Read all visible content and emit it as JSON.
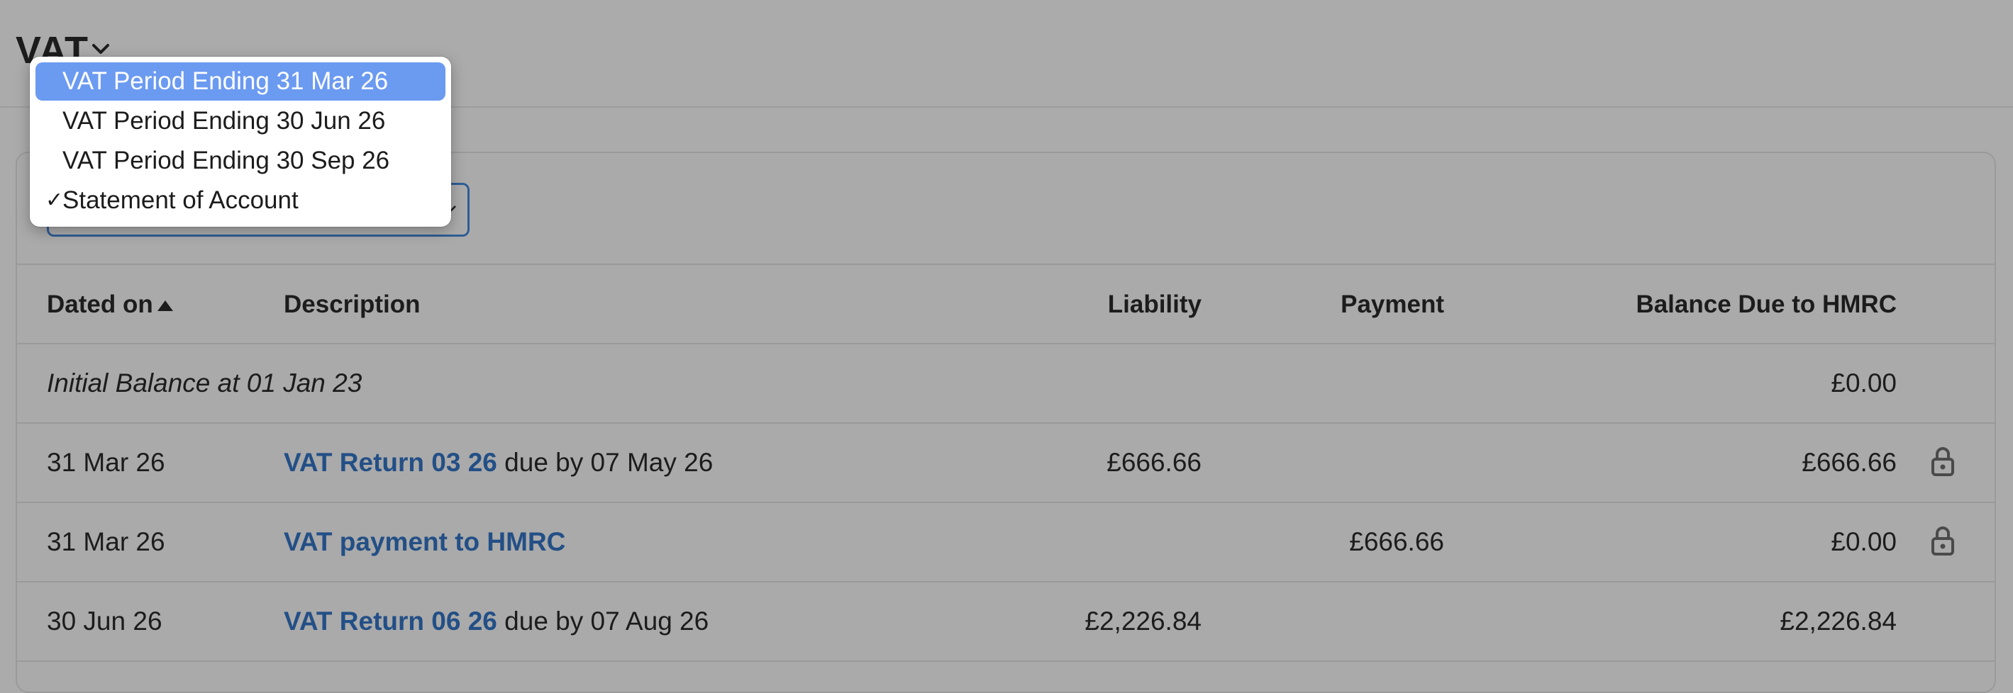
{
  "header": {
    "title": "VAT",
    "title_icon": "chevron-down-icon"
  },
  "dropdown": {
    "items": [
      {
        "label": "VAT Period Ending 31 Mar 26",
        "highlighted": true,
        "checked": false
      },
      {
        "label": "VAT Period Ending 30 Jun 26",
        "highlighted": false,
        "checked": false
      },
      {
        "label": "VAT Period Ending 30 Sep 26",
        "highlighted": false,
        "checked": false
      },
      {
        "label": "Statement of Account",
        "highlighted": false,
        "checked": true
      }
    ],
    "check_glyph": "✓"
  },
  "table": {
    "columns": {
      "dated_on": "Dated on",
      "description": "Description",
      "liability": "Liability",
      "payment": "Payment",
      "balance": "Balance Due to HMRC"
    },
    "sort": {
      "column": "dated_on",
      "direction": "ascending"
    },
    "initial": {
      "label": "Initial Balance at 01 Jan 23",
      "balance": "£0.00"
    },
    "rows": [
      {
        "date": "31 Mar 26",
        "link": "VAT Return 03 26",
        "suffix": " due by 07 May 26",
        "liability": "£666.66",
        "payment": "",
        "balance": "£666.66",
        "locked": true
      },
      {
        "date": "31 Mar 26",
        "link": "VAT payment to HMRC",
        "suffix": "",
        "liability": "",
        "payment": "£666.66",
        "balance": "£0.00",
        "locked": true
      },
      {
        "date": "30 Jun 26",
        "link": "VAT Return 06 26",
        "suffix": " due by 07 Aug 26",
        "liability": "£2,226.84",
        "payment": "",
        "balance": "£2,226.84",
        "locked": false
      }
    ]
  },
  "colors": {
    "link": "#234f86",
    "highlight": "#6b9af1",
    "select_border": "#2f5d95",
    "backdrop": "#ababab"
  }
}
